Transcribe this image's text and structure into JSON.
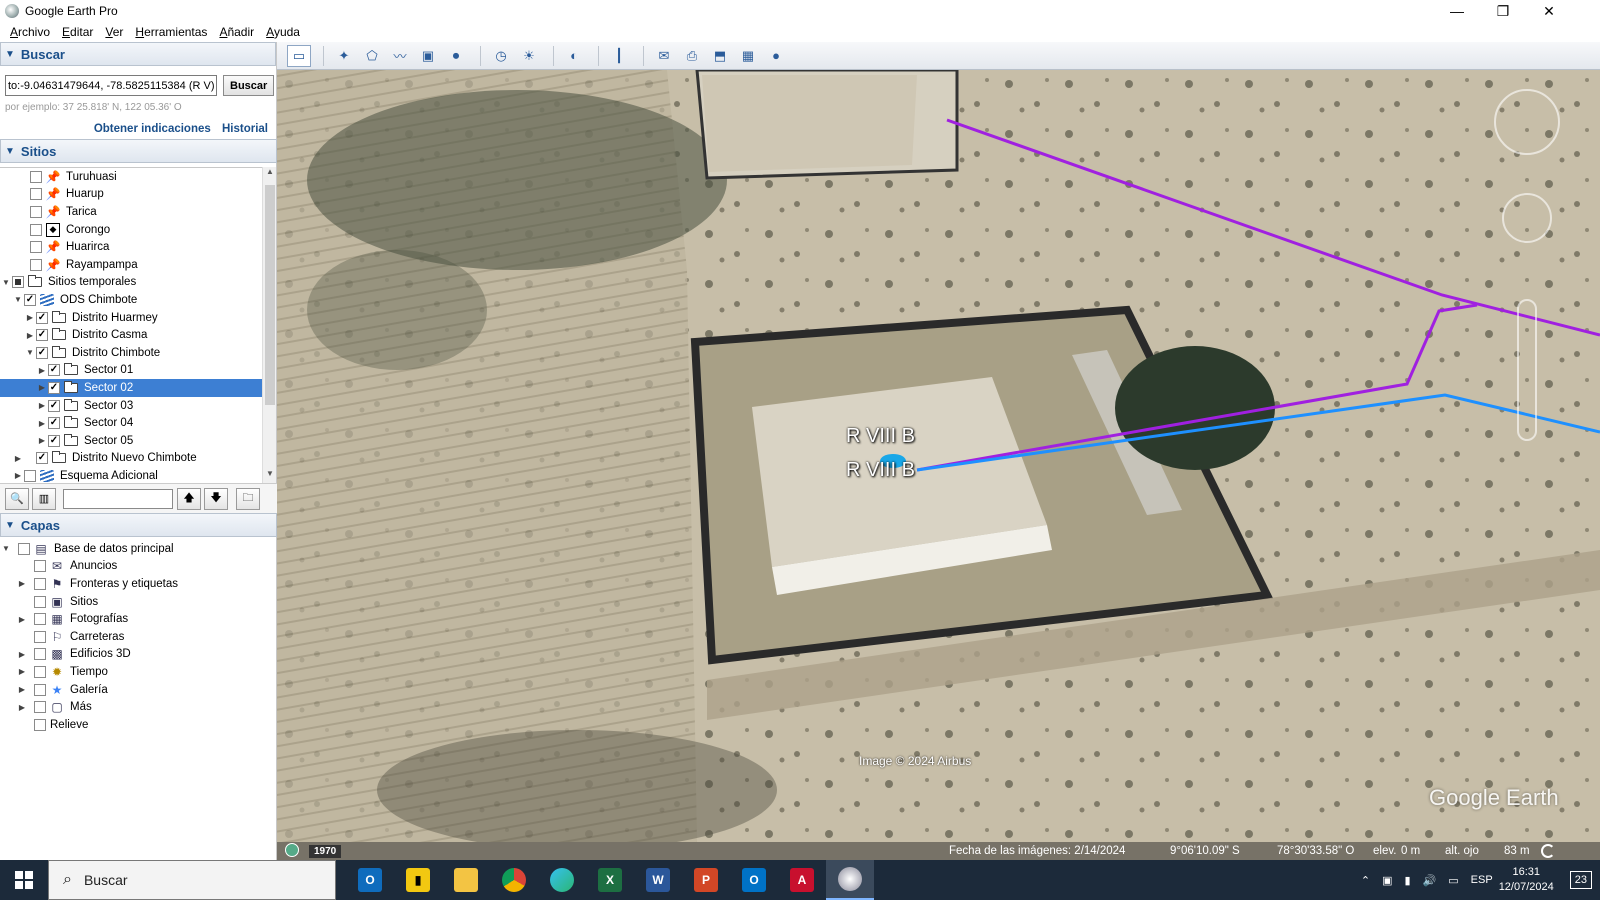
{
  "window": {
    "title": "Google Earth Pro",
    "minimize": "—",
    "maximize": "❐",
    "close": "✕"
  },
  "menu": [
    "Archivo",
    "Editar",
    "Ver",
    "Herramientas",
    "Añadir",
    "Ayuda"
  ],
  "search": {
    "header": "Buscar",
    "query": "to:-9.04631479644, -78.5825115384 (R V)",
    "button": "Buscar",
    "hint": "por ejemplo: 37 25.818' N, 122 05.36' O",
    "link_directions": "Obtener indicaciones",
    "link_history": "Historial"
  },
  "places": {
    "header": "Sitios",
    "items": [
      {
        "label": "Turuhuasi",
        "icon": "yellow-pushpin-icon",
        "checked": false
      },
      {
        "label": "Huarup",
        "icon": "yellow-pushpin-icon",
        "checked": false
      },
      {
        "label": "Tarica",
        "icon": "yellow-pushpin-icon",
        "checked": false
      },
      {
        "label": "Corongo",
        "icon": "diamond-marker-icon",
        "checked": false
      },
      {
        "label": "Huarirca",
        "icon": "yellow-pushpin-icon",
        "checked": false
      },
      {
        "label": "Rayampampa",
        "icon": "yellow-pushpin-icon",
        "checked": false
      },
      {
        "label": "Sitios temporales",
        "icon": "folder-icon",
        "checked": "partial"
      },
      {
        "label": "ODS Chimbote",
        "icon": "network-link-icon",
        "checked": true
      },
      {
        "label": "Distrito Huarmey",
        "icon": "folder-icon",
        "checked": true
      },
      {
        "label": "Distrito Casma",
        "icon": "folder-icon",
        "checked": true
      },
      {
        "label": "Distrito Chimbote",
        "icon": "folder-open-icon",
        "checked": true
      },
      {
        "label": "Sector 01",
        "icon": "folder-icon",
        "checked": true
      },
      {
        "label": "Sector 02",
        "icon": "folder-icon",
        "checked": true,
        "selected": true
      },
      {
        "label": "Sector 03",
        "icon": "folder-icon",
        "checked": true
      },
      {
        "label": "Sector 04",
        "icon": "folder-icon",
        "checked": true
      },
      {
        "label": "Sector 05",
        "icon": "folder-icon",
        "checked": true
      },
      {
        "label": "Distrito Nuevo Chimbote",
        "icon": "folder-icon",
        "checked": true
      },
      {
        "label": "Esquema Adicional",
        "icon": "network-link-icon",
        "checked": false
      }
    ]
  },
  "layers": {
    "header": "Capas",
    "items": [
      {
        "label": "Base de datos principal",
        "icon": "database-icon"
      },
      {
        "label": "Anuncios",
        "icon": "envelope-icon"
      },
      {
        "label": "Fronteras y etiquetas",
        "icon": "flag-icon"
      },
      {
        "label": "Sitios",
        "icon": "places-icon"
      },
      {
        "label": "Fotografías",
        "icon": "photo-icon"
      },
      {
        "label": "Carreteras",
        "icon": "road-icon"
      },
      {
        "label": "Edificios 3D",
        "icon": "building-icon"
      },
      {
        "label": "Tiempo",
        "icon": "sun-icon"
      },
      {
        "label": "Galería",
        "icon": "star-icon"
      },
      {
        "label": "Más",
        "icon": "more-icon"
      },
      {
        "label": "Relieve",
        "icon": "none"
      }
    ]
  },
  "map": {
    "label_top": "R VIII B",
    "label_bottom": "R VIII B",
    "copyright": "Image © 2024 Airbus",
    "watermark": "Google Earth",
    "year": "1970",
    "status": {
      "date": "Fecha de las imágenes: 2/14/2024",
      "lat": "9°06'10.09\" S",
      "lon": "78°30'33.58\" O",
      "elev_label": "elev.",
      "elev": "0 m",
      "eye_label": "alt. ojo",
      "eye": "83 m"
    },
    "line_colors": {
      "purple": "#a020e0",
      "blue": "#1e90ff"
    }
  },
  "taskbar": {
    "search": "Buscar",
    "lang": "ESP",
    "time": "16:31",
    "date": "12/07/2024",
    "notifications": "23"
  }
}
